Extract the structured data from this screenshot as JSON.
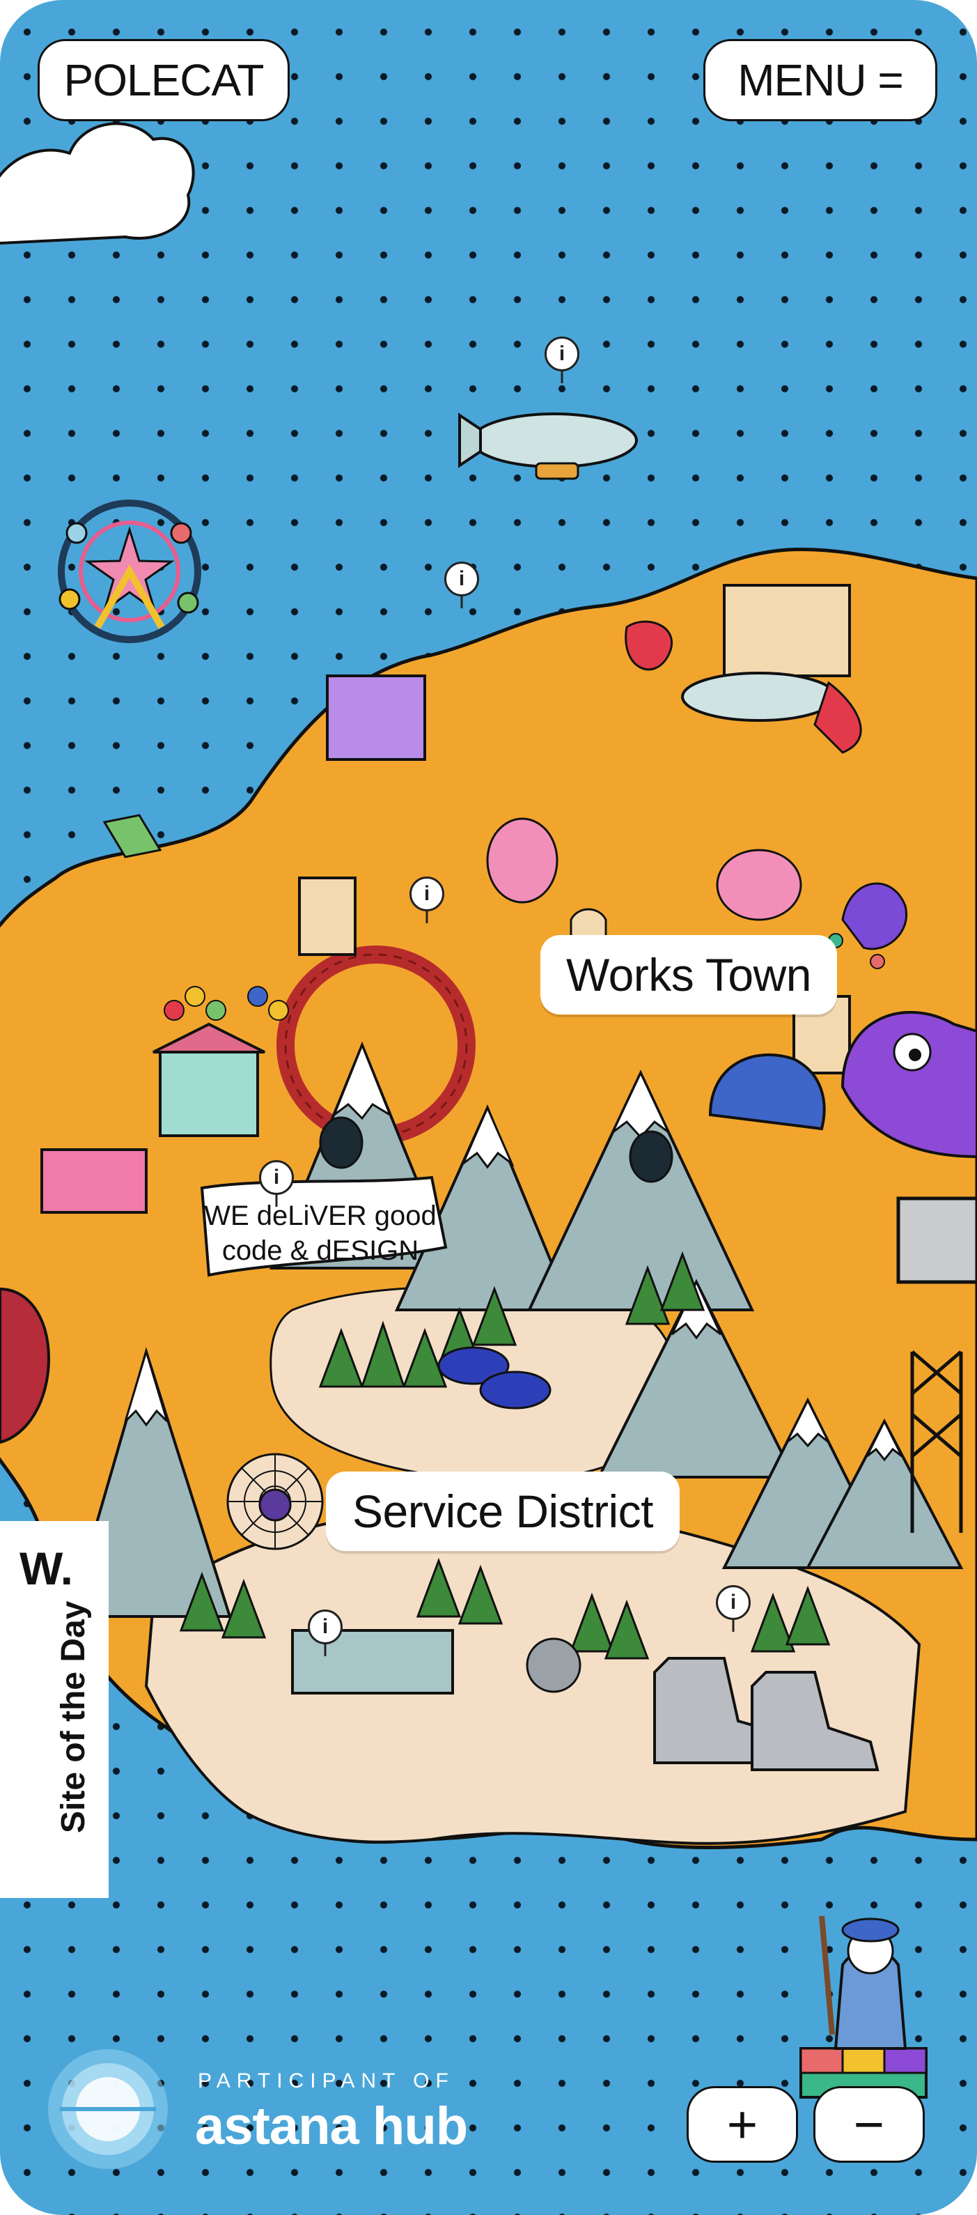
{
  "header": {
    "logo_label": "POLECAT",
    "menu_label": "MENU ="
  },
  "map": {
    "districts": [
      {
        "label": "Works Town"
      },
      {
        "label": "Service District"
      }
    ],
    "banner_text_line1": "WE deLiVER good",
    "banner_text_line2": "code & dESIGN",
    "info_marker_glyph": "i"
  },
  "badge": {
    "initial": "W.",
    "text": "Site of the Day"
  },
  "partner": {
    "small_text": "PARTICIPANT OF",
    "name": "astana hub"
  },
  "zoom": {
    "in_label": "+",
    "out_label": "−"
  },
  "colors": {
    "sea": "#4aa6d8",
    "land": "#f2a52d",
    "snow_mountain": "#9fb8bc",
    "forest": "#3d8a3a",
    "sand": "#f4dfc6"
  }
}
